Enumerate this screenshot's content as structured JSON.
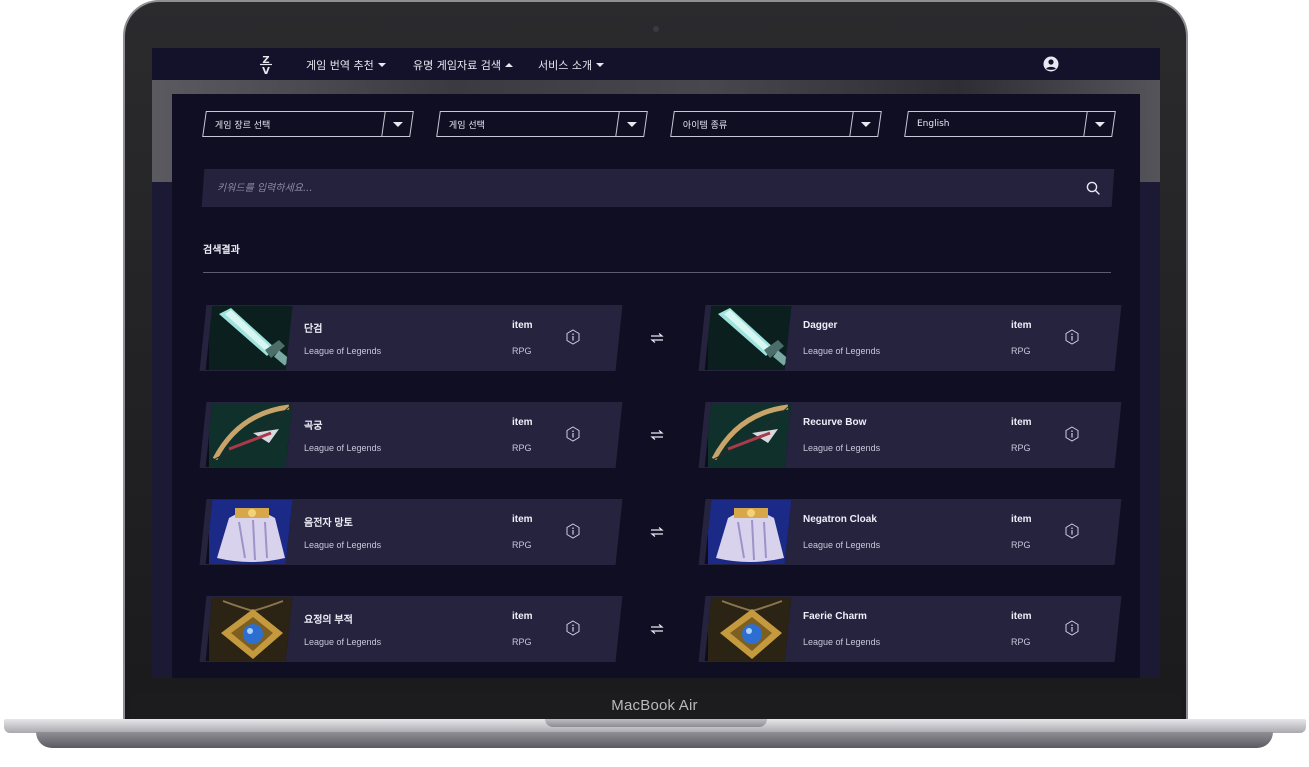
{
  "device": {
    "model_label": "MacBook Air"
  },
  "nav": {
    "logo_text": "Z\nV",
    "items": [
      {
        "label": "게임 번역 추천",
        "caret": "down"
      },
      {
        "label": "유명 게임자료 검색",
        "caret": "up"
      },
      {
        "label": "서비스 소개",
        "caret": "down"
      }
    ],
    "user_icon": "user-circle-icon"
  },
  "filters": {
    "genre": "게임 장르 선택",
    "game": "게임 선택",
    "item_type": "아이템 종류",
    "language": "English"
  },
  "search": {
    "placeholder": "키워드를 입력하세요...",
    "icon": "search-icon"
  },
  "results": {
    "title": "검색결과",
    "rows": [
      {
        "thumb": "dagger",
        "left": {
          "name": "단검",
          "game": "League of Legends",
          "type": "item",
          "genre": "RPG"
        },
        "right": {
          "name": "Dagger",
          "game": "League of Legends",
          "type": "item",
          "genre": "RPG"
        }
      },
      {
        "thumb": "bow",
        "left": {
          "name": "곡궁",
          "game": "League of Legends",
          "type": "item",
          "genre": "RPG"
        },
        "right": {
          "name": "Recurve Bow",
          "game": "League of Legends",
          "type": "item",
          "genre": "RPG"
        }
      },
      {
        "thumb": "cloak",
        "left": {
          "name": "음전자 망토",
          "game": "League of Legends",
          "type": "item",
          "genre": "RPG"
        },
        "right": {
          "name": "Negatron Cloak",
          "game": "League of Legends",
          "type": "item",
          "genre": "RPG"
        }
      },
      {
        "thumb": "charm",
        "left": {
          "name": "요정의 부적",
          "game": "League of Legends",
          "type": "item",
          "genre": "RPG"
        },
        "right": {
          "name": "Faerie Charm",
          "game": "League of Legends",
          "type": "item",
          "genre": "RPG"
        }
      }
    ]
  },
  "colors": {
    "background": "#16142b",
    "panel": "#100e22",
    "card": "#25233e",
    "text": "#f0eff8"
  }
}
